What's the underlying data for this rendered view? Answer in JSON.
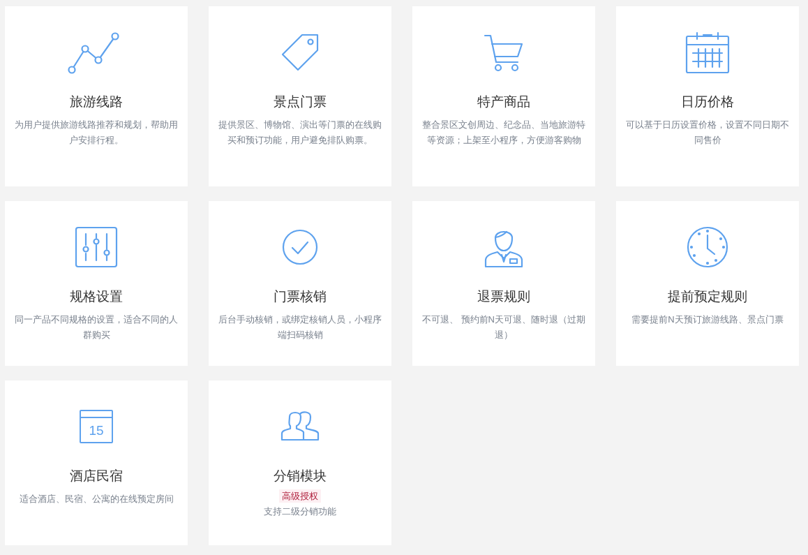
{
  "features": [
    {
      "title": "旅游线路",
      "description": "为用户提供旅游线路推荐和规划，帮助用户安排行程。"
    },
    {
      "title": "景点门票",
      "description": "提供景区、博物馆、演出等门票的在线购买和预订功能，用户避免排队购票。"
    },
    {
      "title": "特产商品",
      "description": "整合景区文创周边、纪念品、当地旅游特等资源；上架至小程序，方便游客购物"
    },
    {
      "title": "日历价格",
      "description": "可以基于日历设置价格，设置不同日期不同售价"
    },
    {
      "title": "规格设置",
      "description": "同一产品不同规格的设置，适合不同的人群购买"
    },
    {
      "title": "门票核销",
      "description": "后台手动核销，或绑定核销人员，小程序端扫码核销"
    },
    {
      "title": "退票规则",
      "description": "不可退、 预约前N天可退、随时退（过期退）"
    },
    {
      "title": "提前预定规则",
      "description": "需要提前N天预订旅游线路、景点门票"
    },
    {
      "title": "酒店民宿",
      "icon_text": "15",
      "description": "适合酒店、民宿、公寓的在线预定房间"
    },
    {
      "title": "分销模块",
      "badge": "高级授权",
      "description": "支持二级分销功能"
    }
  ]
}
